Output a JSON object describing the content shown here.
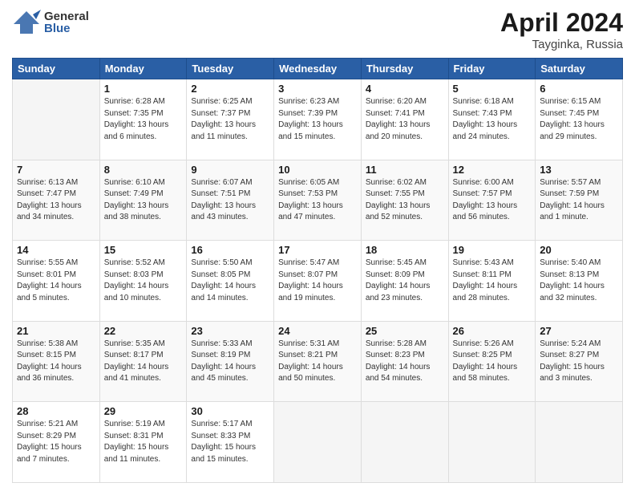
{
  "header": {
    "logo_general": "General",
    "logo_blue": "Blue",
    "month_title": "April 2024",
    "location": "Tayginka, Russia"
  },
  "days_of_week": [
    "Sunday",
    "Monday",
    "Tuesday",
    "Wednesday",
    "Thursday",
    "Friday",
    "Saturday"
  ],
  "weeks": [
    [
      {
        "day": "",
        "info": ""
      },
      {
        "day": "1",
        "info": "Sunrise: 6:28 AM\nSunset: 7:35 PM\nDaylight: 13 hours\nand 6 minutes."
      },
      {
        "day": "2",
        "info": "Sunrise: 6:25 AM\nSunset: 7:37 PM\nDaylight: 13 hours\nand 11 minutes."
      },
      {
        "day": "3",
        "info": "Sunrise: 6:23 AM\nSunset: 7:39 PM\nDaylight: 13 hours\nand 15 minutes."
      },
      {
        "day": "4",
        "info": "Sunrise: 6:20 AM\nSunset: 7:41 PM\nDaylight: 13 hours\nand 20 minutes."
      },
      {
        "day": "5",
        "info": "Sunrise: 6:18 AM\nSunset: 7:43 PM\nDaylight: 13 hours\nand 24 minutes."
      },
      {
        "day": "6",
        "info": "Sunrise: 6:15 AM\nSunset: 7:45 PM\nDaylight: 13 hours\nand 29 minutes."
      }
    ],
    [
      {
        "day": "7",
        "info": "Sunrise: 6:13 AM\nSunset: 7:47 PM\nDaylight: 13 hours\nand 34 minutes."
      },
      {
        "day": "8",
        "info": "Sunrise: 6:10 AM\nSunset: 7:49 PM\nDaylight: 13 hours\nand 38 minutes."
      },
      {
        "day": "9",
        "info": "Sunrise: 6:07 AM\nSunset: 7:51 PM\nDaylight: 13 hours\nand 43 minutes."
      },
      {
        "day": "10",
        "info": "Sunrise: 6:05 AM\nSunset: 7:53 PM\nDaylight: 13 hours\nand 47 minutes."
      },
      {
        "day": "11",
        "info": "Sunrise: 6:02 AM\nSunset: 7:55 PM\nDaylight: 13 hours\nand 52 minutes."
      },
      {
        "day": "12",
        "info": "Sunrise: 6:00 AM\nSunset: 7:57 PM\nDaylight: 13 hours\nand 56 minutes."
      },
      {
        "day": "13",
        "info": "Sunrise: 5:57 AM\nSunset: 7:59 PM\nDaylight: 14 hours\nand 1 minute."
      }
    ],
    [
      {
        "day": "14",
        "info": "Sunrise: 5:55 AM\nSunset: 8:01 PM\nDaylight: 14 hours\nand 5 minutes."
      },
      {
        "day": "15",
        "info": "Sunrise: 5:52 AM\nSunset: 8:03 PM\nDaylight: 14 hours\nand 10 minutes."
      },
      {
        "day": "16",
        "info": "Sunrise: 5:50 AM\nSunset: 8:05 PM\nDaylight: 14 hours\nand 14 minutes."
      },
      {
        "day": "17",
        "info": "Sunrise: 5:47 AM\nSunset: 8:07 PM\nDaylight: 14 hours\nand 19 minutes."
      },
      {
        "day": "18",
        "info": "Sunrise: 5:45 AM\nSunset: 8:09 PM\nDaylight: 14 hours\nand 23 minutes."
      },
      {
        "day": "19",
        "info": "Sunrise: 5:43 AM\nSunset: 8:11 PM\nDaylight: 14 hours\nand 28 minutes."
      },
      {
        "day": "20",
        "info": "Sunrise: 5:40 AM\nSunset: 8:13 PM\nDaylight: 14 hours\nand 32 minutes."
      }
    ],
    [
      {
        "day": "21",
        "info": "Sunrise: 5:38 AM\nSunset: 8:15 PM\nDaylight: 14 hours\nand 36 minutes."
      },
      {
        "day": "22",
        "info": "Sunrise: 5:35 AM\nSunset: 8:17 PM\nDaylight: 14 hours\nand 41 minutes."
      },
      {
        "day": "23",
        "info": "Sunrise: 5:33 AM\nSunset: 8:19 PM\nDaylight: 14 hours\nand 45 minutes."
      },
      {
        "day": "24",
        "info": "Sunrise: 5:31 AM\nSunset: 8:21 PM\nDaylight: 14 hours\nand 50 minutes."
      },
      {
        "day": "25",
        "info": "Sunrise: 5:28 AM\nSunset: 8:23 PM\nDaylight: 14 hours\nand 54 minutes."
      },
      {
        "day": "26",
        "info": "Sunrise: 5:26 AM\nSunset: 8:25 PM\nDaylight: 14 hours\nand 58 minutes."
      },
      {
        "day": "27",
        "info": "Sunrise: 5:24 AM\nSunset: 8:27 PM\nDaylight: 15 hours\nand 3 minutes."
      }
    ],
    [
      {
        "day": "28",
        "info": "Sunrise: 5:21 AM\nSunset: 8:29 PM\nDaylight: 15 hours\nand 7 minutes."
      },
      {
        "day": "29",
        "info": "Sunrise: 5:19 AM\nSunset: 8:31 PM\nDaylight: 15 hours\nand 11 minutes."
      },
      {
        "day": "30",
        "info": "Sunrise: 5:17 AM\nSunset: 8:33 PM\nDaylight: 15 hours\nand 15 minutes."
      },
      {
        "day": "",
        "info": ""
      },
      {
        "day": "",
        "info": ""
      },
      {
        "day": "",
        "info": ""
      },
      {
        "day": "",
        "info": ""
      }
    ]
  ]
}
